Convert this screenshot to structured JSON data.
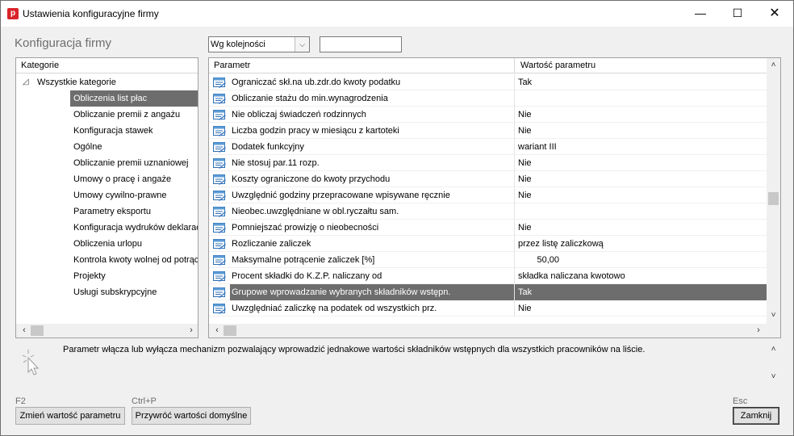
{
  "window": {
    "title": "Ustawienia konfiguracyjne firmy",
    "icon_letter": "p",
    "minimize": "—",
    "maximize": "☐",
    "close": "✕"
  },
  "heading": "Konfiguracja firmy",
  "sort": {
    "selected": "Wg kolejności",
    "arrow": "⌵"
  },
  "search": {
    "value": ""
  },
  "categories": {
    "header": "Kategorie",
    "root": "Wszystkie kategorie",
    "items": [
      "Obliczenia list płac",
      "Obliczanie premii z angażu",
      "Konfiguracja stawek",
      "Ogólne",
      "Obliczanie premii uznaniowej",
      "Umowy o pracę i angaże",
      "Umowy cywilno-prawne",
      "Parametry eksportu",
      "Konfiguracja wydruków deklaracji",
      "Obliczenia urlopu",
      "Kontrola kwoty wolnej od potrąceń",
      "Projekty",
      "Usługi subskrypcyjne"
    ],
    "selected_index": 0
  },
  "params": {
    "col_name": "Parametr",
    "col_value": "Wartość parametru",
    "rows": [
      {
        "name": "Ograniczać skł.na ub.zdr.do kwoty podatku",
        "value": "Tak"
      },
      {
        "name": "Obliczanie stażu do min.wynagrodzenia",
        "value": ""
      },
      {
        "name": "Nie obliczaj świadczeń rodzinnych",
        "value": "Nie"
      },
      {
        "name": "Liczba godzin pracy w miesiącu z kartoteki",
        "value": "Nie"
      },
      {
        "name": "Dodatek funkcyjny",
        "value": "wariant III"
      },
      {
        "name": "Nie stosuj par.11 rozp.",
        "value": "Nie"
      },
      {
        "name": "Koszty ograniczone do kwoty przychodu",
        "value": "Nie"
      },
      {
        "name": "Uwzględnić godziny przepracowane wpisywane ręcznie",
        "value": "Nie"
      },
      {
        "name": "Nieobec.uwzględniane w obl.ryczałtu sam.",
        "value": ""
      },
      {
        "name": "Pomniejszać prowizję o nieobecności",
        "value": "Nie"
      },
      {
        "name": "Rozliczanie zaliczek",
        "value": "przez listę zaliczkową"
      },
      {
        "name": "Maksymalne potrącenie zaliczek [%]",
        "value": "50,00"
      },
      {
        "name": "Procent składki do K.Z.P. naliczany od",
        "value": "składka naliczana kwotowo"
      },
      {
        "name": "Grupowe wprowadzanie wybranych składników wstępn.",
        "value": "Tak"
      },
      {
        "name": "Uwzględniać zaliczkę na podatek od wszystkich prz.",
        "value": "Nie"
      }
    ],
    "selected_index": 13
  },
  "description": "Parametr włącza lub wyłącza mechanizm pozwalający wprowadzić jednakowe wartości składników wstępnych dla wszystkich pracowników na liście.",
  "buttons": {
    "change": {
      "shortcut": "F2",
      "label": "Zmień wartość parametru"
    },
    "restore": {
      "shortcut": "Ctrl+P",
      "label": "Przywróć wartości domyślne"
    },
    "close": {
      "shortcut": "Esc",
      "label": "Zamknij"
    }
  },
  "arrows": {
    "left": "‹",
    "right": "›",
    "up": "˄",
    "down": "˅"
  }
}
